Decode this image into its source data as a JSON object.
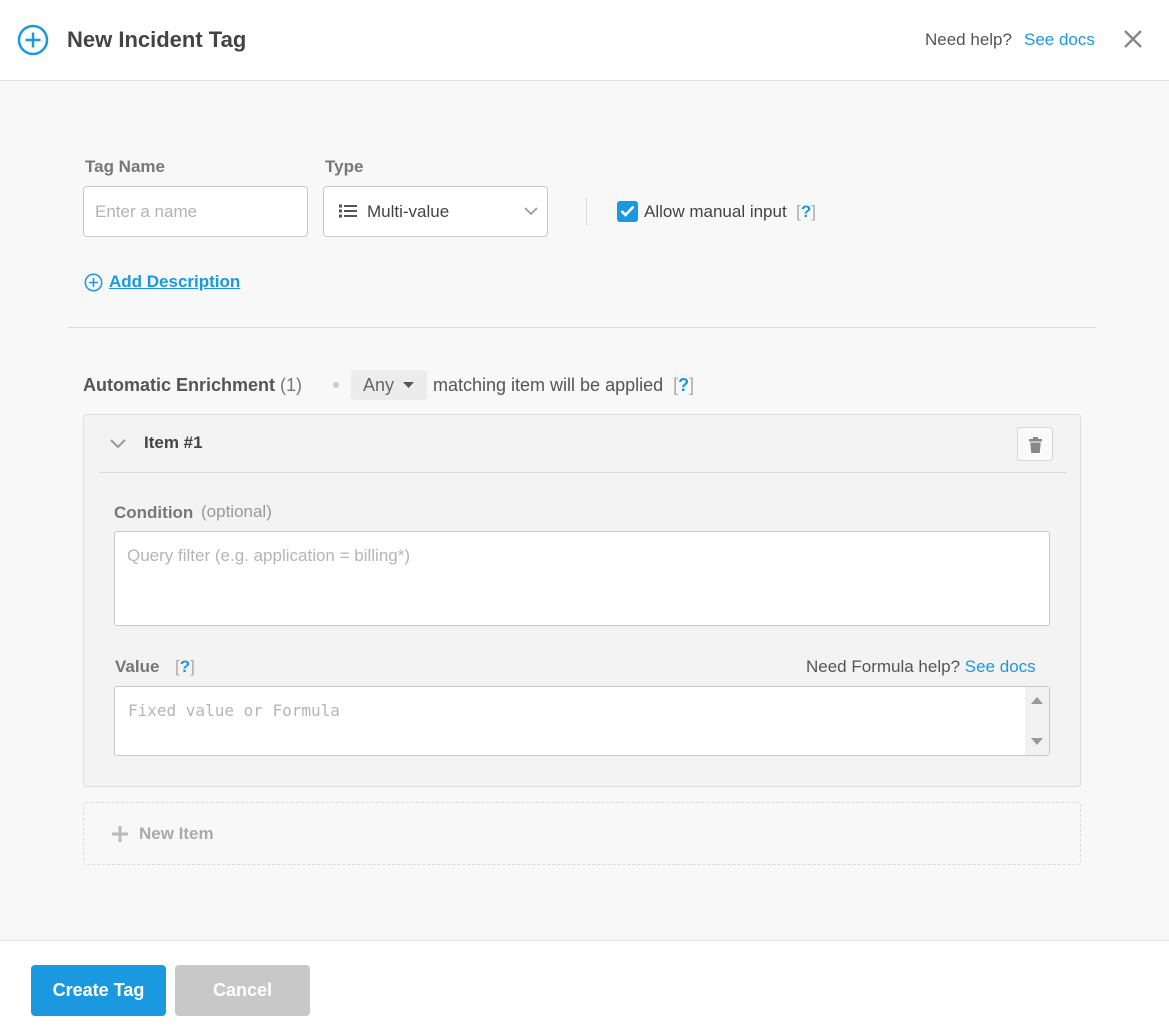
{
  "header": {
    "title": "New Incident Tag",
    "help_prefix": "Need help?",
    "help_link": "See docs"
  },
  "form": {
    "tag_name_label": "Tag Name",
    "tag_name_placeholder": "Enter a name",
    "tag_name_value": "",
    "type_label": "Type",
    "type_value": "Multi-value",
    "allow_manual_input_label": "Allow manual input",
    "allow_manual_input_checked": true,
    "help_mark": "?",
    "add_description": "Add Description"
  },
  "enrichment": {
    "title": "Automatic Enrichment",
    "count": "(1)",
    "match_mode": "Any",
    "match_text": "matching item will be applied",
    "help_mark": "?"
  },
  "item": {
    "title": "Item #1",
    "condition_label": "Condition",
    "condition_optional": "(optional)",
    "condition_placeholder": "Query filter (e.g. application = billing*)",
    "value_label": "Value",
    "value_help_mark": "?",
    "formula_help_prefix": "Need Formula help?",
    "formula_help_link": "See docs",
    "value_placeholder": "Fixed value or Formula"
  },
  "new_item_label": "New Item",
  "footer": {
    "create_label": "Create Tag",
    "cancel_label": "Cancel"
  },
  "colors": {
    "accent": "#1a98e0",
    "cancel_bg": "#c8c8c8",
    "background": "#f8f8f8"
  },
  "icons": [
    "plus-circle-icon",
    "close-icon",
    "list-icon",
    "chevron-down-icon",
    "check-icon",
    "add-circle-icon",
    "caret-down-icon",
    "trash-icon",
    "plus-icon",
    "scroll-up-icon",
    "scroll-down-icon"
  ]
}
